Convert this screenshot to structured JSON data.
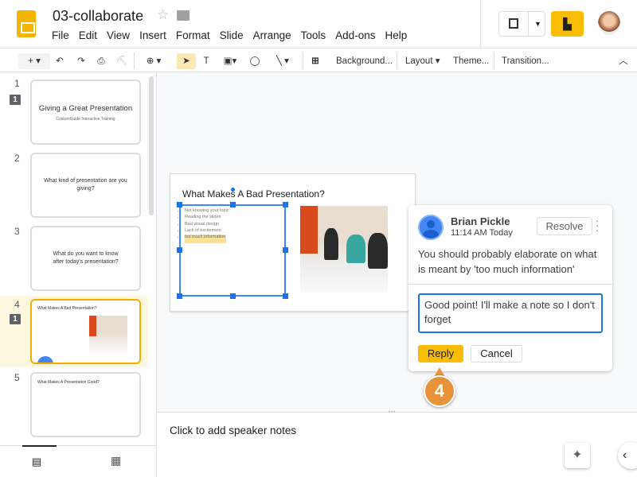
{
  "header": {
    "title": "03-collaborate",
    "menu": [
      "File",
      "Edit",
      "View",
      "Insert",
      "Format",
      "Slide",
      "Arrange",
      "Tools",
      "Add-ons",
      "Help"
    ]
  },
  "toolbar": {
    "background": "Background...",
    "layout": "Layout",
    "theme": "Theme...",
    "transition": "Transition..."
  },
  "slides": [
    {
      "num": "1",
      "comments": "1",
      "title": "Giving a Great Presentation",
      "subtitle": "CustomGuide Interactive Training"
    },
    {
      "num": "2",
      "title": "What kind of presentation are you giving?"
    },
    {
      "num": "3",
      "title": "What do you want to know after today's presentation?"
    },
    {
      "num": "4",
      "comments": "1",
      "title": "What Makes A Bad Presentation?"
    },
    {
      "num": "5",
      "title": "What Makes A Presentation Good?"
    }
  ],
  "current_slide": {
    "title": "What Makes A Bad Presentation?",
    "bullets": [
      "Not knowing your topic",
      "Reading the slides",
      "Bad visual design",
      "Lack of excitement",
      "too much information"
    ]
  },
  "notes": {
    "placeholder": "Click to add speaker notes"
  },
  "comment": {
    "author": "Brian Pickle",
    "time": "11:14 AM Today",
    "resolve": "Resolve",
    "text": "You should probably elaborate on what is meant by 'too much information'",
    "reply_value": "Good point! I'll make a note so I don't forget",
    "reply": "Reply",
    "cancel": "Cancel"
  },
  "step": "4",
  "colors": {
    "accent": "#fbbc04",
    "selection": "#1a73e8",
    "step": "#e8923a"
  }
}
